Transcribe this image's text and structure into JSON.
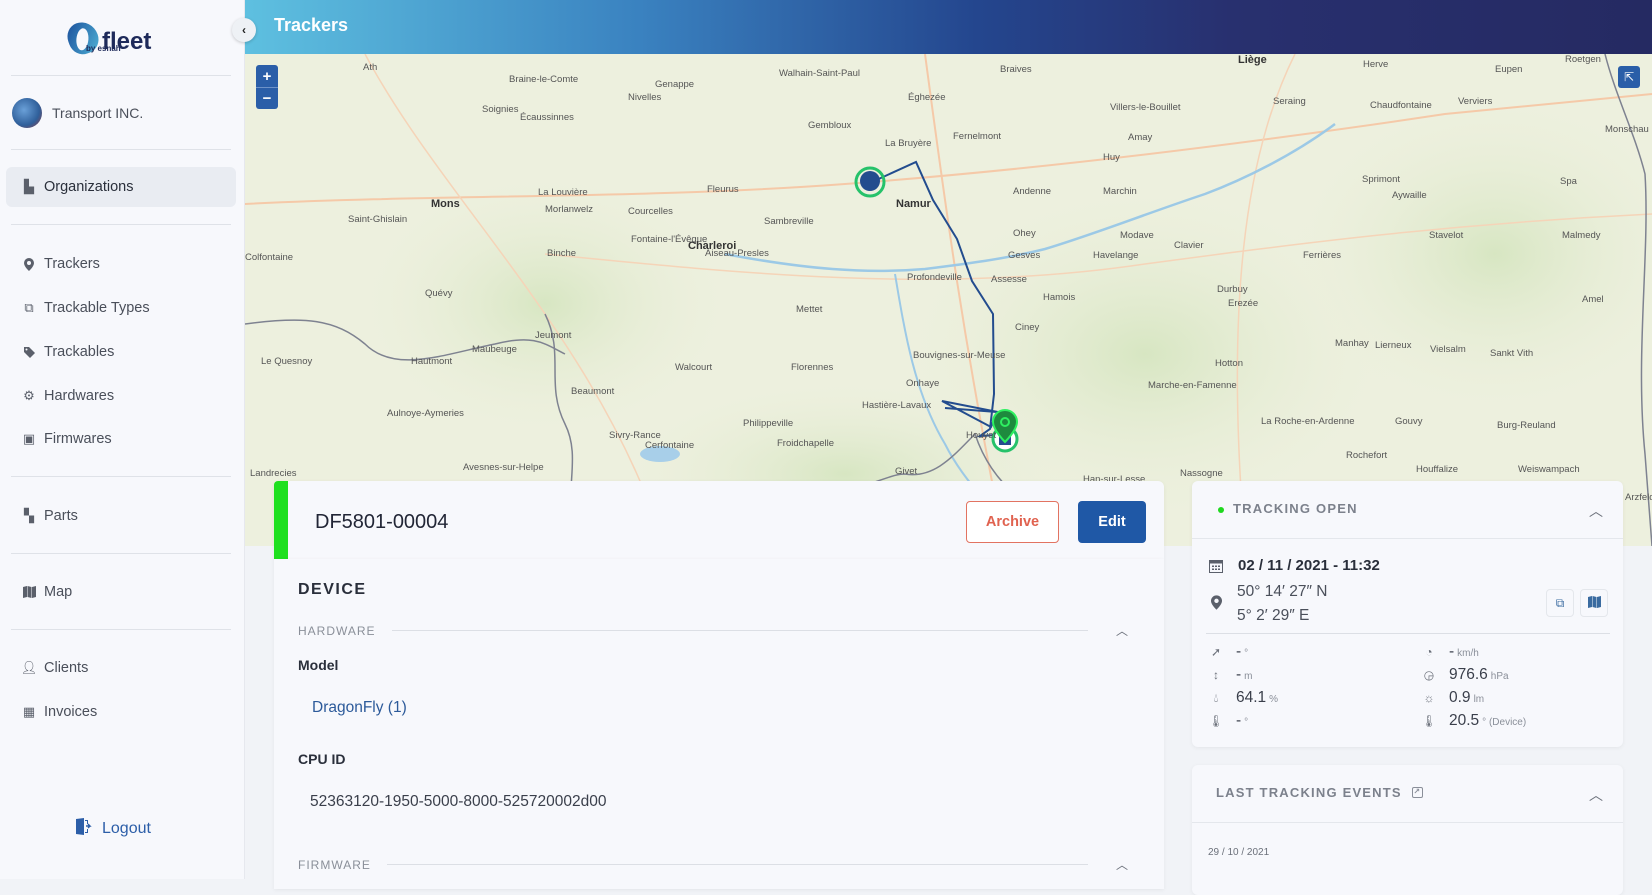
{
  "app": {
    "logo_text": "fleet",
    "logo_sub": "by esnah",
    "organization": "Transport INC."
  },
  "sidebar": {
    "items": [
      {
        "label": "Organizations",
        "icon": "buildings-icon",
        "active": true
      },
      {
        "label": "Trackers",
        "icon": "map-pin-icon"
      },
      {
        "label": "Trackable Types",
        "icon": "copy-icon"
      },
      {
        "label": "Trackables",
        "icon": "tag-icon"
      },
      {
        "label": "Hardwares",
        "icon": "hardware-icon"
      },
      {
        "label": "Firmwares",
        "icon": "chip-icon"
      },
      {
        "label": "Parts",
        "icon": "puzzle-icon"
      },
      {
        "label": "Map",
        "icon": "map-icon"
      },
      {
        "label": "Clients",
        "icon": "users-icon"
      },
      {
        "label": "Invoices",
        "icon": "grid-icon"
      }
    ],
    "logout_label": "Logout",
    "collapse_glyph": "‹"
  },
  "header": {
    "title": "Trackers"
  },
  "map": {
    "zoom_in": "+",
    "zoom_out": "−",
    "fullscreen_glyph": "⇱",
    "labels": [
      {
        "text": "Ath"
      },
      {
        "text": "Braine-le-Comte"
      },
      {
        "text": "Nivelles"
      },
      {
        "text": "Genappe"
      },
      {
        "text": "Walhain-Saint-Paul"
      },
      {
        "text": "Braives"
      },
      {
        "text": "Liège"
      },
      {
        "text": "Herve"
      },
      {
        "text": "Eupen"
      },
      {
        "text": "Roetgen"
      },
      {
        "text": "Soignies"
      },
      {
        "text": "Écaussinnes"
      },
      {
        "text": "Gembloux"
      },
      {
        "text": "Éghezée"
      },
      {
        "text": "Villers-le-Bouillet"
      },
      {
        "text": "Seraing"
      },
      {
        "text": "Chaudfontaine"
      },
      {
        "text": "Verviers"
      },
      {
        "text": "Monschau"
      },
      {
        "text": "La Bruyère"
      },
      {
        "text": "Fernelmont"
      },
      {
        "text": "Amay"
      },
      {
        "text": "Huy"
      },
      {
        "text": "Spa"
      },
      {
        "text": "Fleurus"
      },
      {
        "text": "La Louvière"
      },
      {
        "text": "Mons"
      },
      {
        "text": "Namur"
      },
      {
        "text": "Andenne"
      },
      {
        "text": "Marchin"
      },
      {
        "text": "Sprimont"
      },
      {
        "text": "Aywaille"
      },
      {
        "text": "Saint-Ghislain"
      },
      {
        "text": "Morlanwelz"
      },
      {
        "text": "Courcelles"
      },
      {
        "text": "Sambreville"
      },
      {
        "text": "Charleroi"
      },
      {
        "text": "Binche"
      },
      {
        "text": "Fontaine-l'Évêque"
      },
      {
        "text": "Aiseau-Presles"
      },
      {
        "text": "Ohey"
      },
      {
        "text": "Modave"
      },
      {
        "text": "Colfontaine"
      },
      {
        "text": "Gesves"
      },
      {
        "text": "Havelange"
      },
      {
        "text": "Clavier"
      },
      {
        "text": "Ferrières"
      },
      {
        "text": "Stavelot"
      },
      {
        "text": "Malmedy"
      },
      {
        "text": "Profondeville"
      },
      {
        "text": "Assesse"
      },
      {
        "text": "Hamois"
      },
      {
        "text": "Durbuy"
      },
      {
        "text": "Quévy"
      },
      {
        "text": "Mettet"
      },
      {
        "text": "Erezée"
      },
      {
        "text": "Amel"
      },
      {
        "text": "Jeumont"
      },
      {
        "text": "Maubeuge"
      },
      {
        "text": "Ciney"
      },
      {
        "text": "Manhay"
      },
      {
        "text": "Lierneux"
      },
      {
        "text": "Vielsalm"
      },
      {
        "text": "Sankt Vith"
      },
      {
        "text": "Le Quesnoy"
      },
      {
        "text": "Hautmont"
      },
      {
        "text": "Beaumont"
      },
      {
        "text": "Walcourt"
      },
      {
        "text": "Florennes"
      },
      {
        "text": "Bouvignes-sur-Meuse"
      },
      {
        "text": "Hotton"
      },
      {
        "text": "Onhaye"
      },
      {
        "text": "Hastière-Lavaux"
      },
      {
        "text": "Marche-en-Famenne"
      },
      {
        "text": "Aulnoye-Aymeries"
      },
      {
        "text": "Philippeville"
      },
      {
        "text": "Houyet"
      },
      {
        "text": "La Roche-en-Ardenne"
      },
      {
        "text": "Gouvy"
      },
      {
        "text": "Burg-Reuland"
      },
      {
        "text": "Rochefort"
      },
      {
        "text": "Sivry-Rance"
      },
      {
        "text": "Cerfontaine"
      },
      {
        "text": "Froidchapelle"
      },
      {
        "text": "Landrecies"
      },
      {
        "text": "Avesnes-sur-Helpe"
      },
      {
        "text": "Givet"
      },
      {
        "text": "Han-sur-Lesse"
      },
      {
        "text": "Nassogne"
      },
      {
        "text": "Houffalize"
      },
      {
        "text": "Weiswampach"
      },
      {
        "text": "Arzfeld"
      }
    ]
  },
  "device": {
    "id": "DF5801-00004",
    "status_color": "#1fe01f",
    "archive_label": "Archive",
    "edit_label": "Edit",
    "section_title": "DEVICE",
    "hardware_header": "HARDWARE",
    "model_label": "Model",
    "model_value": "DragonFly (1)",
    "cpu_label": "CPU ID",
    "cpu_value": "52363120-1950-5000-8000-525720002d00",
    "firmware_header": "FIRMWARE"
  },
  "tracking": {
    "title": "TRACKING OPEN",
    "status_color": "#1fd81f",
    "datetime": "02 / 11 / 2021 - 11:32",
    "lat": "50° 14′ 27″ N",
    "lon": "5° 2′ 29″ E",
    "copy_icon": "⧉",
    "map_icon": "▥",
    "metrics": {
      "heading": {
        "value": "-",
        "unit": "°"
      },
      "speed": {
        "value": "-",
        "unit": "km/h"
      },
      "altitude": {
        "value": "-",
        "unit": "m"
      },
      "pressure": {
        "value": "976.6",
        "unit": "hPa"
      },
      "humidity": {
        "value": "64.1",
        "unit": "%"
      },
      "light": {
        "value": "0.9",
        "unit": "lm"
      },
      "temperature": {
        "value": "-",
        "unit": "°"
      },
      "device_temperature": {
        "value": "20.5",
        "unit": "° (Device)"
      }
    }
  },
  "events": {
    "title": "LAST TRACKING EVENTS",
    "first_date": "29 / 10 / 2021"
  }
}
